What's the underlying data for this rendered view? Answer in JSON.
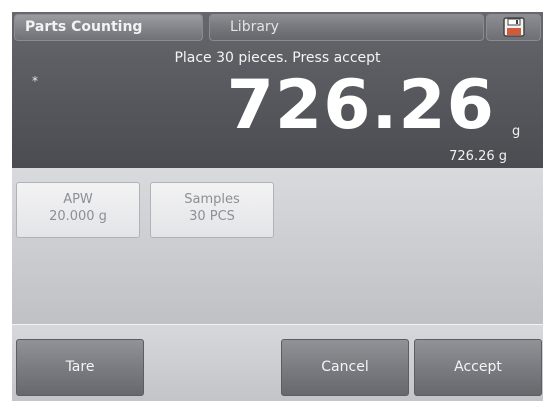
{
  "header": {
    "mode_tab": "Parts Counting",
    "library_tab": "Library",
    "save_icon": "floppy-disk-icon"
  },
  "display": {
    "instruction": "Place 30 pieces.  Press accept",
    "stability_marker": "*",
    "weight_value": "726.26",
    "weight_unit": "g",
    "weight_secondary": "726.26 g"
  },
  "info": {
    "apw_label": "APW",
    "apw_value": "20.000 g",
    "samples_label": "Samples",
    "samples_value": "30 PCS"
  },
  "buttons": {
    "tare": "Tare",
    "cancel": "Cancel",
    "accept": "Accept"
  },
  "colors": {
    "header_dark": "#5a5c61",
    "body_light": "#c9cbcf",
    "button_gray": "#7a7c81",
    "save_icon_accent": "#d05a3a"
  }
}
